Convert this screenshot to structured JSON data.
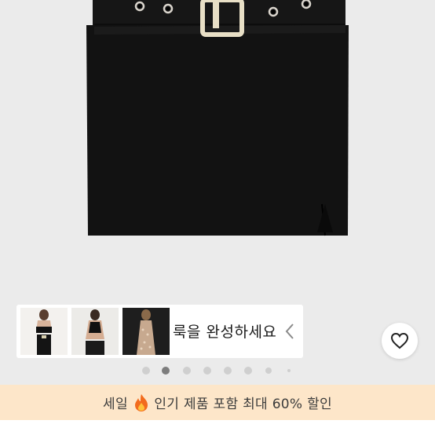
{
  "complete_look": {
    "label": "룩을 완성하세요",
    "thumbnails": [
      {
        "icon": "model-black-crop-top-photo"
      },
      {
        "icon": "model-black-halter-top-photo"
      },
      {
        "icon": "model-sequin-dress-photo"
      }
    ]
  },
  "carousel": {
    "total": 8,
    "active_index": 1
  },
  "sale_banner": {
    "prefix": "세일",
    "icon": "fire-icon",
    "text": "인기 제품 포함 최대 60% 할인"
  },
  "colors": {
    "banner_bg": "#fde6c9",
    "skirt": "#121212",
    "buckle": "#e8dfc6"
  }
}
